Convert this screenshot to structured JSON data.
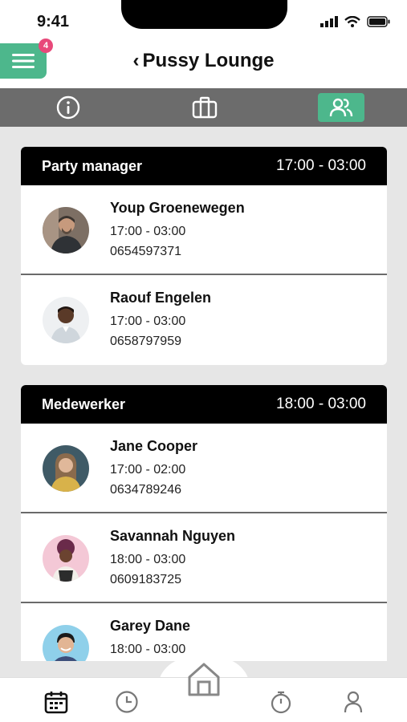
{
  "status": {
    "time": "9:41"
  },
  "header": {
    "title": "Pussy Lounge",
    "notification_count": "4"
  },
  "tabs": [
    {
      "name": "info-icon",
      "active": false
    },
    {
      "name": "briefcase-icon",
      "active": false
    },
    {
      "name": "people-icon",
      "active": true
    }
  ],
  "groups": [
    {
      "role": "Party manager",
      "hours": "17:00 - 03:00",
      "people": [
        {
          "name": "Youp Groenewegen",
          "hours": "17:00 - 03:00",
          "phone": "0654597371"
        },
        {
          "name": "Raouf Engelen",
          "hours": "17:00 - 03:00",
          "phone": "0658797959"
        }
      ]
    },
    {
      "role": "Medewerker",
      "hours": "18:00 - 03:00",
      "people": [
        {
          "name": "Jane Cooper",
          "hours": "17:00 - 02:00",
          "phone": "0634789246"
        },
        {
          "name": "Savannah Nguyen",
          "hours": "18:00 - 03:00",
          "phone": "0609183725"
        },
        {
          "name": "Garey Dane",
          "hours": "18:00 - 03:00",
          "phone": ""
        }
      ]
    }
  ],
  "bottom_nav": [
    "calendar-icon",
    "clock-icon",
    "home-icon",
    "stopwatch-icon",
    "profile-icon"
  ],
  "colors": {
    "accent": "#4db78c",
    "badge": "#e8497a",
    "header_bar": "#6c6c6c"
  }
}
